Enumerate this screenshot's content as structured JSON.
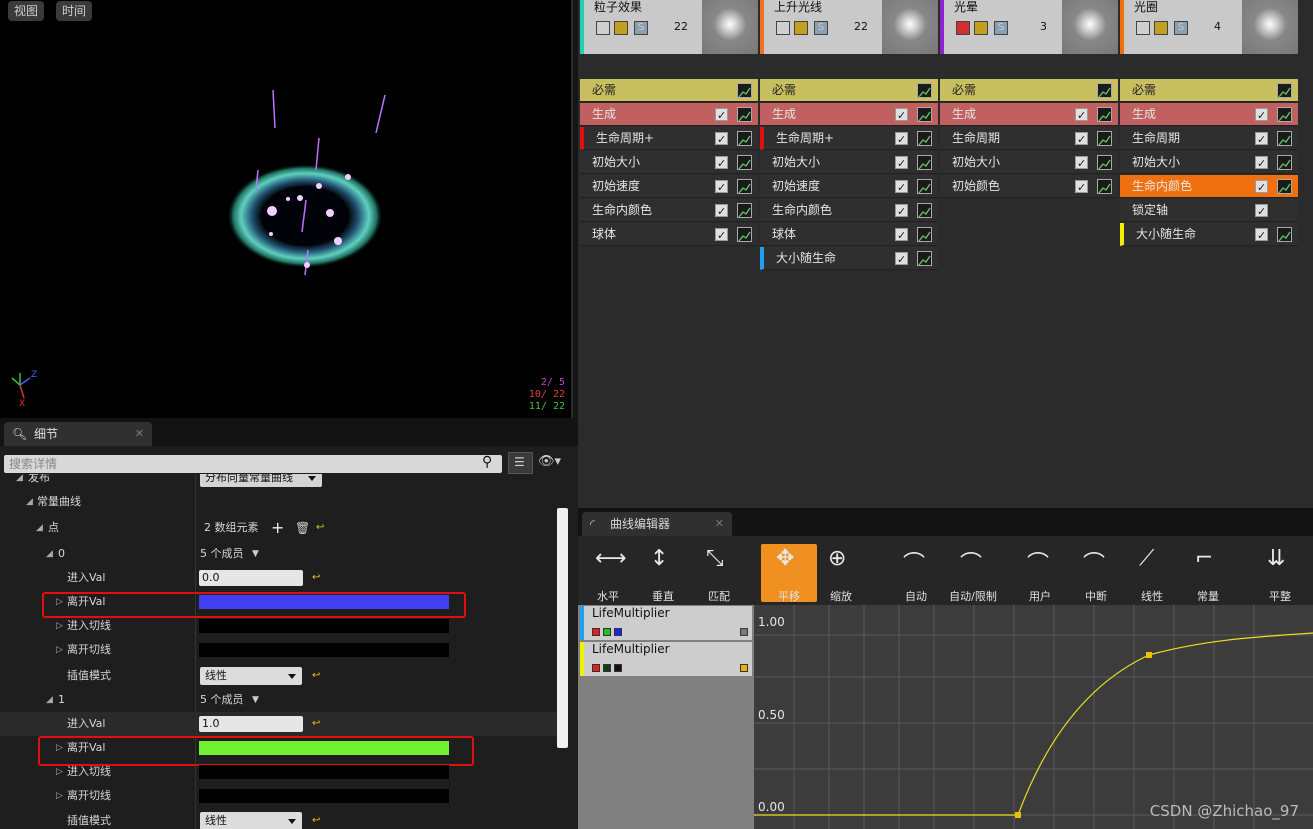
{
  "viewport": {
    "buttons": [
      "视图",
      "时间"
    ],
    "stats": [
      {
        "text": "2/  5",
        "color": "#c040c0"
      },
      {
        "text": "10/ 22",
        "color": "#e04040"
      },
      {
        "text": "11/ 22",
        "color": "#40c040"
      }
    ]
  },
  "details": {
    "tab_label": "细节",
    "search_placeholder": "搜索详情",
    "rows": {
      "distribution_label": "发布",
      "distribution_value": "分布向量常量曲线",
      "const_curve": "常量曲线",
      "points": "点",
      "points_count": "2 数组元素",
      "p0_index": "0",
      "p0_members": "5 个成员",
      "p0_inval_label": "进入Val",
      "p0_inval": "0.0",
      "p0_outval_label": "离开Val",
      "p0_arrive": "进入切线",
      "p0_leave": "离开切线",
      "p0_interp_label": "插值模式",
      "p0_interp": "线性",
      "p1_index": "1",
      "p1_members": "5 个成员",
      "p1_inval_label": "进入Val",
      "p1_inval": "1.0",
      "p1_outval_label": "离开Val",
      "p1_arrive": "进入切线",
      "p1_leave": "离开切线",
      "p1_interp_label": "插值模式",
      "p1_interp": "线性"
    },
    "colors": {
      "p0_out": "#4040f0",
      "p1_out": "#70f030"
    }
  },
  "emitters": [
    {
      "title": "粒子效果",
      "count": "22",
      "accent": "#20d0b0",
      "modules": [
        "必需",
        "生成",
        "生命周期+",
        "初始大小",
        "初始速度",
        "生命内颜色",
        "球体"
      ]
    },
    {
      "title": "上升光线",
      "count": "22",
      "accent": "#f07020",
      "modules": [
        "必需",
        "生成",
        "生命周期+",
        "初始大小",
        "初始速度",
        "生命内颜色",
        "球体",
        "大小随生命"
      ]
    },
    {
      "title": "光晕",
      "count": "3",
      "accent": "#9020d0",
      "modules": [
        "必需",
        "生成",
        "生命周期",
        "初始大小",
        "初始颜色"
      ]
    },
    {
      "title": "光圈",
      "count": "4",
      "accent": "#f07010",
      "modules": [
        "必需",
        "生成",
        "生命周期",
        "初始大小",
        "生命内颜色",
        "锁定轴",
        "大小随生命"
      ]
    }
  ],
  "curve_editor": {
    "tab_label": "曲线编辑器",
    "tools": [
      "水平",
      "垂直",
      "匹配",
      "平移",
      "缩放",
      "自动",
      "自动/限制",
      "用户",
      "中断",
      "线性",
      "常量",
      "平整"
    ],
    "tracks": [
      {
        "name": "LifeMultiplier"
      },
      {
        "name": "LifeMultiplier"
      }
    ],
    "y_labels": [
      "1.00",
      "0.50",
      "0.00"
    ],
    "watermark": "CSDN @Zhichao_97"
  }
}
